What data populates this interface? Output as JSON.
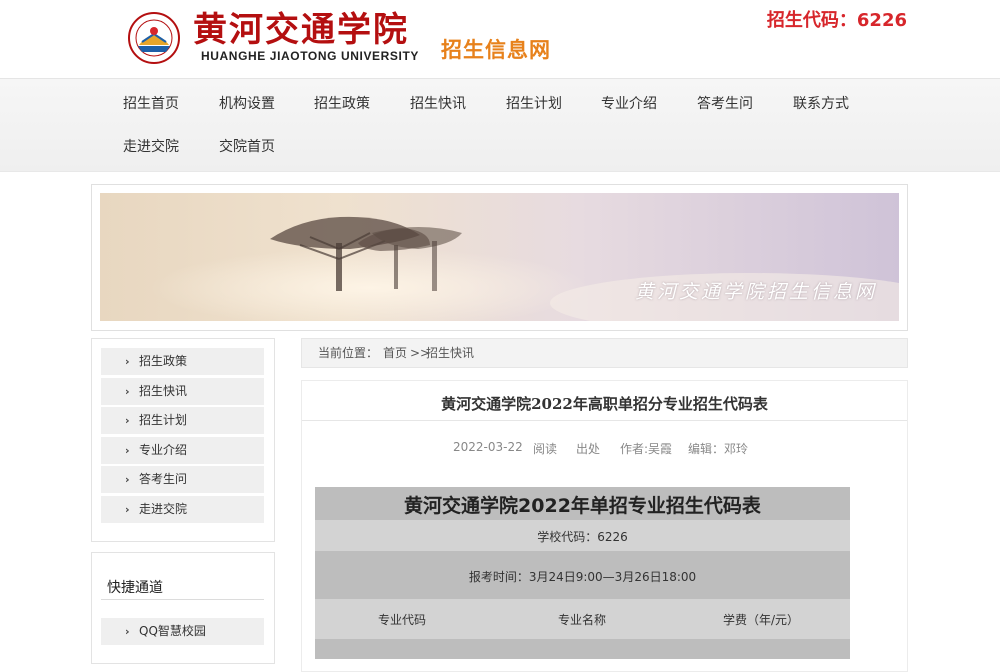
{
  "header": {
    "logo_cn": "黄河交通学院",
    "logo_en": "HUANGHE JIAOTONG UNIVERSITY",
    "site_name": "招生信息网",
    "enroll_code": "招生代码：6226",
    "brand_color": "#b40f10"
  },
  "nav": {
    "items": [
      "招生首页",
      "机构设置",
      "招生政策",
      "招生快讯",
      "招生计划",
      "专业介绍",
      "答考生问",
      "联系方式",
      "走进交院",
      "交院首页"
    ]
  },
  "banner": {
    "caption": "黄河交通学院招生信息网"
  },
  "sidebar": {
    "items": [
      "招生政策",
      "招生快讯",
      "招生计划",
      "专业介绍",
      "答考生问",
      "走进交院"
    ],
    "quick_title": "快捷通道",
    "quick_items": [
      "QQ智慧校园"
    ],
    "chevron_icon": "chevron-right-icon"
  },
  "breadcrumb": {
    "prefix": "当前位置：",
    "home": "首页",
    "sep": ">>",
    "current": "招生快讯"
  },
  "article": {
    "title": "黄河交通学院2022年高职单招分专业招生代码表",
    "date": "2022-03-22",
    "reads": "阅读",
    "source": "出处",
    "author": "作者:吴霞",
    "editor": "编辑：邓玲"
  },
  "table": {
    "title": "黄河交通学院2022年单招专业招生代码表",
    "school_code": "学校代码：6226",
    "exam_time": "报考时间：3月24日9:00—3月26日18:00",
    "headers": [
      "专业代码",
      "专业名称",
      "学费（年/元）"
    ],
    "header_bg": "#bdbdbd",
    "alt_bg": "#d3d3d3"
  }
}
